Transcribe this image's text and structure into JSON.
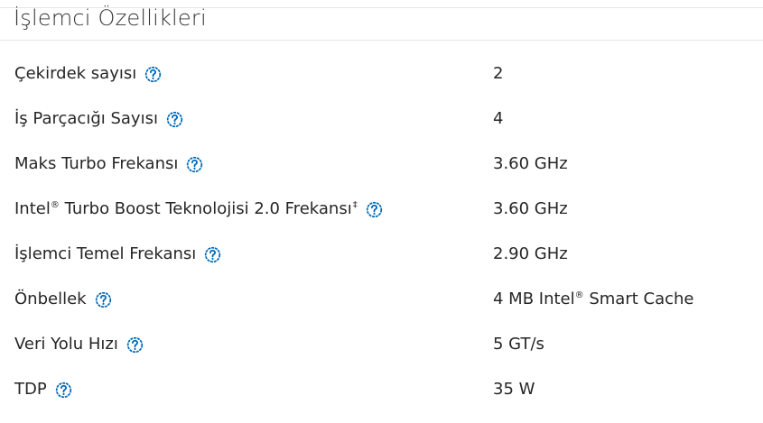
{
  "section": {
    "title": "İşlemci Özellikleri"
  },
  "specs": [
    {
      "label": "Çekirdek sayısı",
      "value": "2"
    },
    {
      "label": "İş Parçacığı Sayısı",
      "value": "4"
    },
    {
      "label": "Maks Turbo Frekansı",
      "value": "3.60 GHz"
    },
    {
      "label_prefix": "Intel",
      "label_suffix": " Turbo Boost Teknolojisi 2.0 Frekansı",
      "reg": "®",
      "dagger": "‡",
      "value": "3.60 GHz"
    },
    {
      "label": "İşlemci Temel Frekansı",
      "value": "2.90 GHz"
    },
    {
      "label": "Önbellek",
      "value_prefix": "4 MB Intel",
      "value_reg": "®",
      "value_suffix": " Smart Cache"
    },
    {
      "label": "Veri Yolu Hızı",
      "value": "5 GT/s"
    },
    {
      "label": "TDP",
      "value": "35 W"
    }
  ],
  "colors": {
    "help_icon": "#0068b5",
    "divider": "#e6e6e6",
    "text": "#262626"
  },
  "icons": {
    "help": "question-circle-icon"
  }
}
